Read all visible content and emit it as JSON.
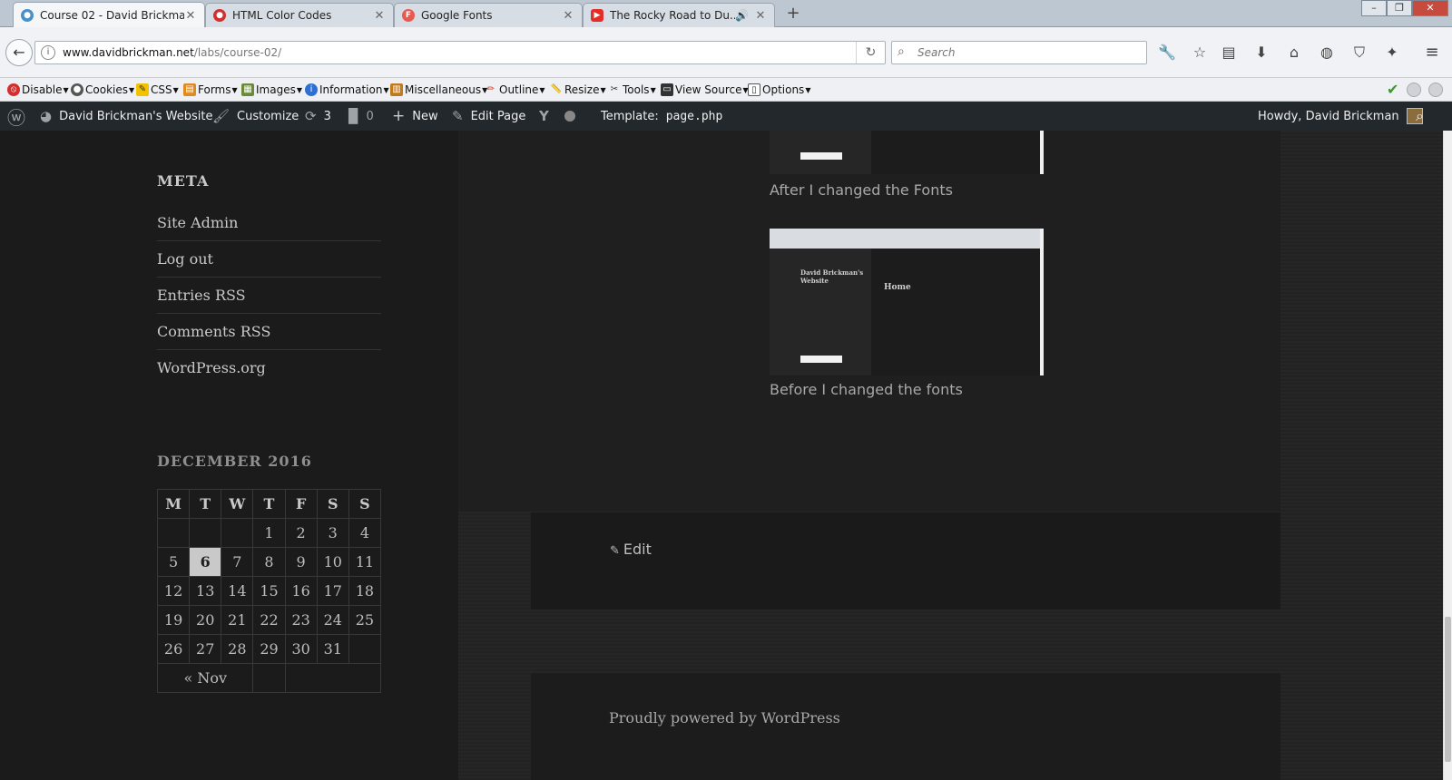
{
  "browser": {
    "tabs": [
      {
        "label": "Course 02 - David Brickma...",
        "active": true
      },
      {
        "label": "HTML Color Codes",
        "active": false
      },
      {
        "label": "Google Fonts",
        "active": false
      },
      {
        "label": "The Rocky Road to Du...",
        "active": false
      }
    ],
    "url_host": "www.davidbrickman.net",
    "url_path": "/labs/course-02/",
    "search_placeholder": "Search"
  },
  "devbar": {
    "items": [
      "Disable",
      "Cookies",
      "CSS",
      "Forms",
      "Images",
      "Information",
      "Miscellaneous",
      "Outline",
      "Resize",
      "Tools",
      "View Source",
      "Options"
    ]
  },
  "adminbar": {
    "site_name": "David Brickman's Website",
    "customize": "Customize",
    "updates_count": "3",
    "comments_count": "0",
    "new": "New",
    "edit_page": "Edit Page",
    "template_label": "Template:",
    "template_file": "page.php",
    "howdy": "Howdy, David Brickman"
  },
  "sidebar": {
    "meta_title": "META",
    "meta_links": [
      "Site Admin",
      "Log out",
      "Entries RSS",
      "Comments RSS",
      "WordPress.org"
    ],
    "calendar_title": "DECEMBER 2016",
    "calendar_days": [
      "M",
      "T",
      "W",
      "T",
      "F",
      "S",
      "S"
    ],
    "calendar_rows": [
      [
        "",
        "",
        "",
        "1",
        "2",
        "3",
        "4"
      ],
      [
        "5",
        "6",
        "7",
        "8",
        "9",
        "10",
        "11"
      ],
      [
        "12",
        "13",
        "14",
        "15",
        "16",
        "17",
        "18"
      ],
      [
        "19",
        "20",
        "21",
        "22",
        "23",
        "24",
        "25"
      ],
      [
        "26",
        "27",
        "28",
        "29",
        "30",
        "31",
        ""
      ]
    ],
    "calendar_today": "6",
    "calendar_prev": "« Nov"
  },
  "content": {
    "caption_after": "After I changed the Fonts",
    "caption_before": "Before I changed the fonts",
    "shot_site_title": "David Brickman's Website",
    "shot_heading": "Home",
    "edit": "Edit",
    "powered": "Proudly powered by WordPress"
  }
}
